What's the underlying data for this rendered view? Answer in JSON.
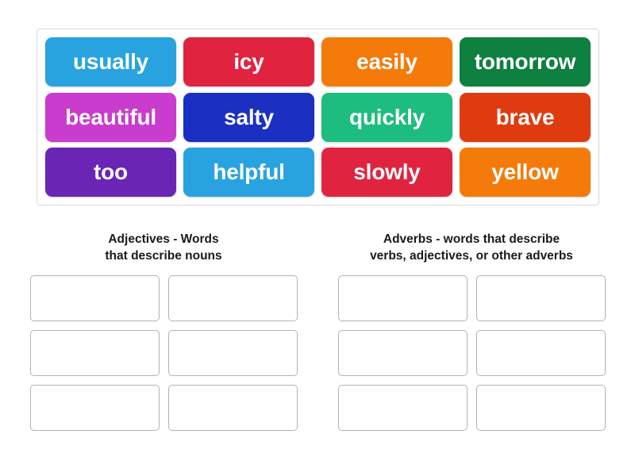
{
  "activity": {
    "type": "group-sort",
    "word_bank": {
      "rows": [
        [
          {
            "label": "usually",
            "color": "#29a3e0"
          },
          {
            "label": "icy",
            "color": "#e02440"
          },
          {
            "label": "easily",
            "color": "#f47b0a"
          },
          {
            "label": "tomorrow",
            "color": "#0e8040"
          }
        ],
        [
          {
            "label": "beautiful",
            "color": "#c93ccd"
          },
          {
            "label": "salty",
            "color": "#1b30c2"
          },
          {
            "label": "quickly",
            "color": "#1dbc7f"
          },
          {
            "label": "brave",
            "color": "#df3b10"
          }
        ],
        [
          {
            "label": "too",
            "color": "#6a25b5"
          },
          {
            "label": "helpful",
            "color": "#29a3e0"
          },
          {
            "label": "slowly",
            "color": "#e02440"
          },
          {
            "label": "yellow",
            "color": "#f47b0a"
          }
        ]
      ]
    },
    "categories": [
      {
        "title": "Adjectives - Words\nthat describe nouns",
        "title_line1": "Adjectives - Words",
        "title_line2": "that describe nouns",
        "dropzones": [
          "",
          "",
          "",
          "",
          "",
          ""
        ]
      },
      {
        "title": "Adverbs - words that describe\nverbs, adjectives, or other adverbs",
        "title_line1": "Adverbs - words that describe",
        "title_line2": "verbs, adjectives, or other adverbs",
        "dropzones": [
          "",
          "",
          "",
          "",
          "",
          ""
        ]
      }
    ],
    "colors": {
      "background": "#ffffff",
      "bank_border": "#d8d8d8",
      "dropzone_border": "#b3b3b3",
      "title_text": "#1a1a1a",
      "tile_text": "#ffffff"
    }
  }
}
